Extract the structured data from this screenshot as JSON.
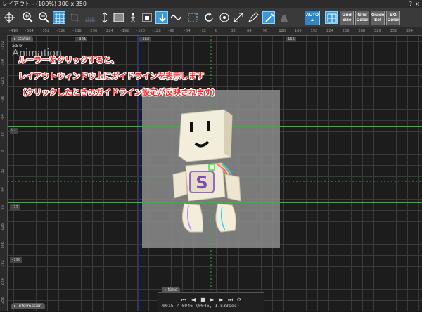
{
  "window": {
    "title": "レイアウト - (100%) 300 x 350",
    "help": "?",
    "close": "×"
  },
  "toolbar": {
    "icons": [
      "crosshair-icon",
      "zoom-in-icon",
      "zoom-out-icon",
      "grid-icon",
      "crop-icon",
      "ruler-icon",
      "height-icon",
      "frame-icon",
      "figure-icon",
      "anchor-icon",
      "arrow-down-icon",
      "wave-icon",
      "dotted-box-icon",
      "rotate-icon",
      "scale-icon",
      "resize-icon",
      "pen-icon",
      "brush-icon",
      "weight-icon"
    ],
    "auto_label": "AUTO",
    "grid_size": "Grid Size",
    "grid_color": "Grid Color",
    "guide_set": "Guide Set",
    "bg_color": "BG Color",
    "accent": "#3a9ad9"
  },
  "ruler": {
    "h_ticks": [
      "-416",
      "-384",
      "-352",
      "-320",
      "-288",
      "-256",
      "-224",
      "-192",
      "-160",
      "-128",
      "-96",
      "-64",
      "-32",
      "0",
      "32",
      "64",
      "96",
      "128",
      "160",
      "192",
      "224",
      "256",
      "288",
      "320",
      "352",
      "384",
      "416"
    ],
    "v_ticks": [
      "-192",
      "-160",
      "-128",
      "-96",
      "-64",
      "-32",
      "0",
      "32",
      "64",
      "96",
      "128",
      "160",
      "192",
      "224",
      "256"
    ],
    "guide_x_labels": [
      "-301",
      "-162",
      "165"
    ],
    "guide_y_labels": [
      "92",
      "-77",
      "-190"
    ]
  },
  "canvas": {
    "status_tag": "status",
    "wm_line1": "SS6",
    "wm_line2": "Animation",
    "messages": [
      "ルーラーをクリックすると、",
      "レイアウトウィンドウ上にガイドラインを表示します",
      "（クリックしたときのガイドライン設定が反映されます）"
    ]
  },
  "time": {
    "tab": "time",
    "timecode": "0015 / 0046 (0046, 1.533sec)"
  },
  "info": {
    "tab": "information"
  },
  "character": {
    "emblem": "S"
  }
}
